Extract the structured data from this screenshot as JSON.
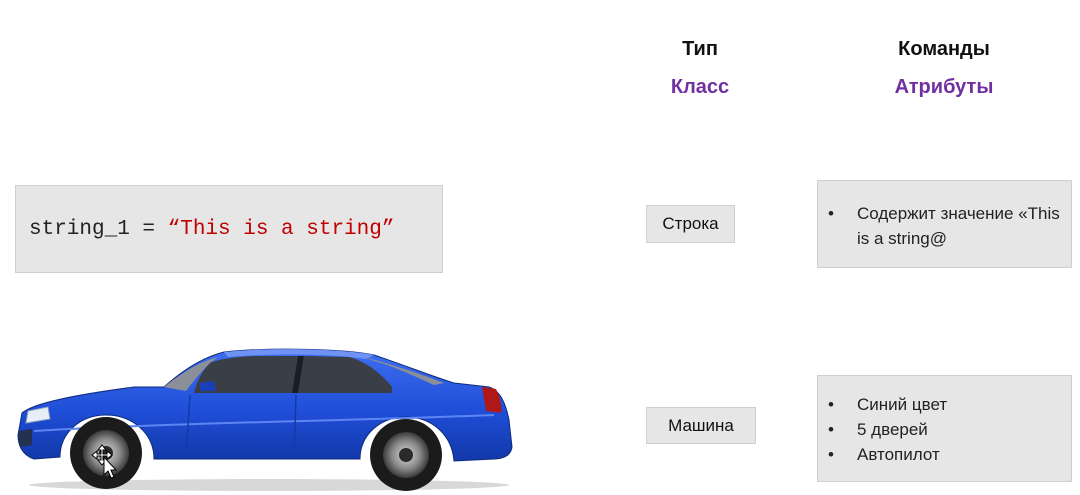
{
  "headers": {
    "type_label": "Тип",
    "commands_label": "Команды",
    "class_label": "Класс",
    "attributes_label": "Атрибуты"
  },
  "code": {
    "prefix": "string_1 = ",
    "string_literal": "“This is a string”"
  },
  "rows": [
    {
      "class_name": "Строка",
      "attributes": [
        "Содержит значение «This is a string@"
      ]
    },
    {
      "class_name": "Машина",
      "attributes": [
        "Синий цвет",
        "5 дверей",
        "Автопилот"
      ]
    }
  ],
  "colors": {
    "header_purple": "#7030a0",
    "string_red": "#c00000",
    "box_gray": "#e6e6e6",
    "car_blue": "#1f4ed8"
  },
  "icons": {
    "car": "blue-sedan-car-image",
    "cursor": "move-cursor-icon"
  }
}
